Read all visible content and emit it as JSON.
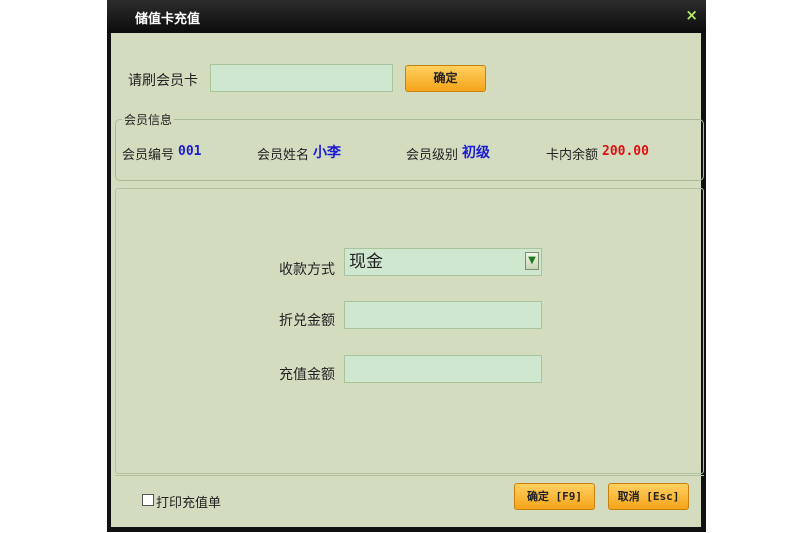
{
  "window": {
    "title": "储值卡充值",
    "close_symbol": "×"
  },
  "swipe": {
    "label": "请刷会员卡",
    "value": "",
    "confirm_label": "确定"
  },
  "member_info": {
    "group_title": "会员信息",
    "id_label": "会员编号",
    "id_value": "001",
    "name_label": "会员姓名",
    "name_value": "小李",
    "level_label": "会员级别",
    "level_value": "初级",
    "balance_label": "卡内余额",
    "balance_value": "200.00"
  },
  "payment": {
    "method_label": "收款方式",
    "method_value": "现金",
    "discount_label": "折兑金额",
    "discount_value": "",
    "recharge_label": "充值金额",
    "recharge_value": ""
  },
  "footer": {
    "print_label": "打印充值单",
    "print_checked": false,
    "ok_label": "确定 [F9]",
    "cancel_label": "取消 [Esc]"
  },
  "colors": {
    "accent_button": "#f5a41a",
    "value_blue": "#1b1bd6",
    "value_red": "#e01010",
    "panel_bg": "#d4dcc0"
  },
  "icons": {
    "dropdown": "chevron-down-icon",
    "close": "close-icon"
  }
}
